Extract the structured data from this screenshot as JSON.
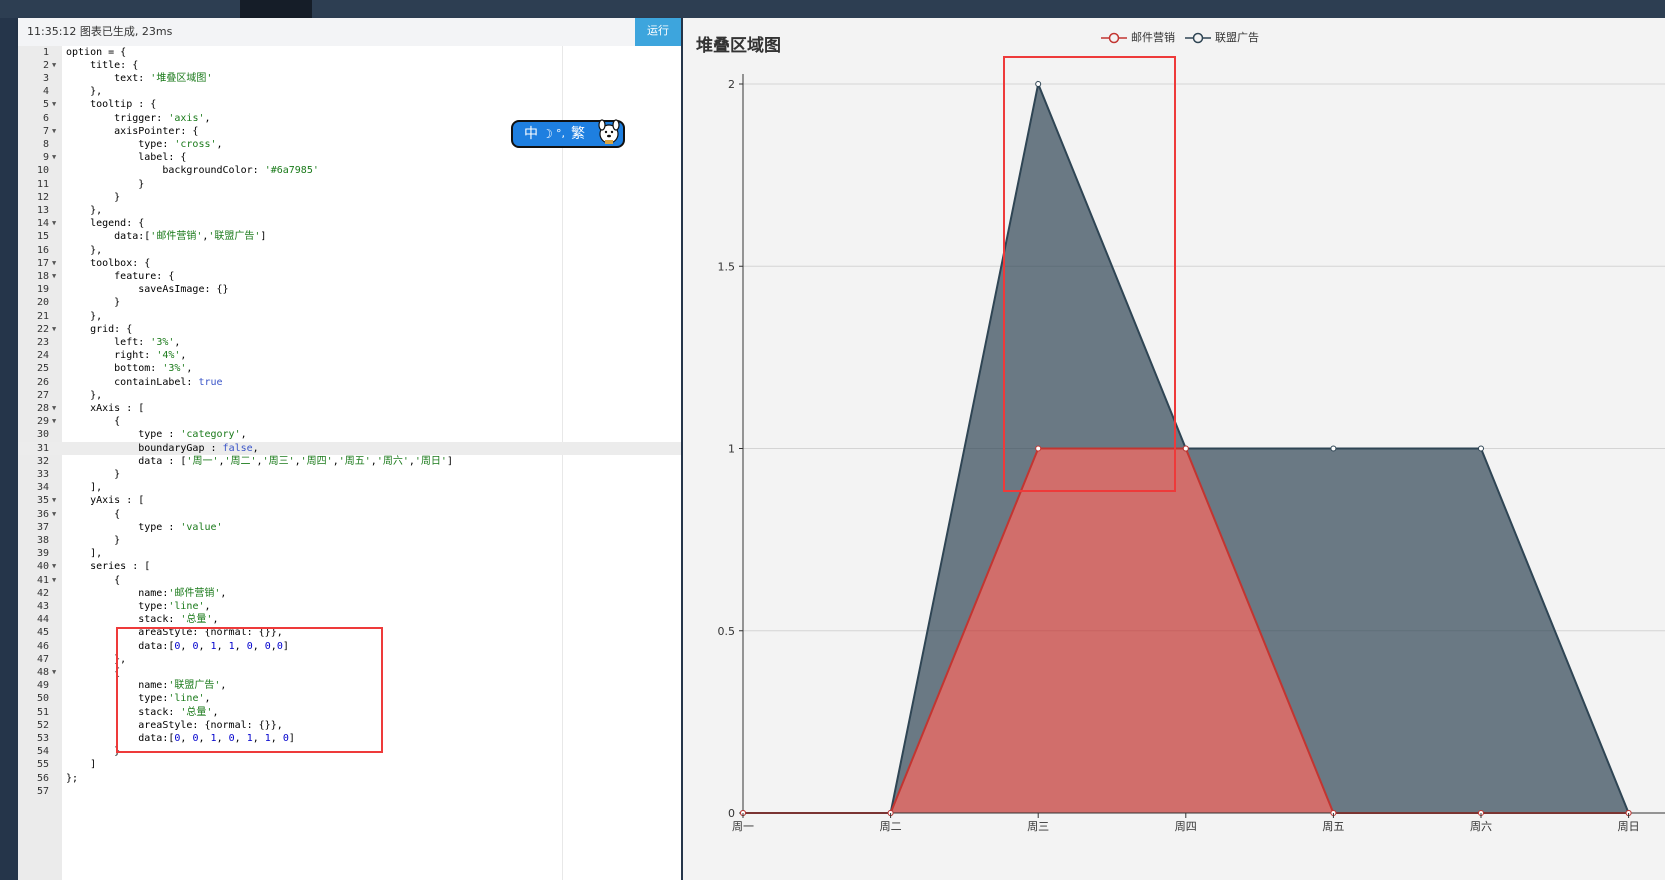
{
  "editor": {
    "status_text": "11:35:12   图表已生成, 23ms",
    "run_label": "运行",
    "code_lines": [
      "option = {",
      "    title: {",
      "        text: '堆叠区域图'",
      "    },",
      "    tooltip : {",
      "        trigger: 'axis',",
      "        axisPointer: {",
      "            type: 'cross',",
      "            label: {",
      "                backgroundColor: '#6a7985'",
      "            }",
      "        }",
      "    },",
      "    legend: {",
      "        data:['邮件营销','联盟广告']",
      "    },",
      "    toolbox: {",
      "        feature: {",
      "            saveAsImage: {}",
      "        }",
      "    },",
      "    grid: {",
      "        left: '3%',",
      "        right: '4%',",
      "        bottom: '3%',",
      "        containLabel: true",
      "    },",
      "    xAxis : [",
      "        {",
      "            type : 'category',",
      "            boundaryGap : false,",
      "            data : ['周一','周二','周三','周四','周五','周六','周日']",
      "        }",
      "    ],",
      "    yAxis : [",
      "        {",
      "            type : 'value'",
      "        }",
      "    ],",
      "    series : [",
      "        {",
      "            name:'邮件营销',",
      "            type:'line',",
      "            stack: '总量',",
      "            areaStyle: {normal: {}},",
      "            data:[0, 0, 1, 1, 0, 0,0]",
      "        },",
      "        {",
      "            name:'联盟广告',",
      "            type:'line',",
      "            stack: '总量',",
      "            areaStyle: {normal: {}},",
      "            data:[0, 0, 1, 0, 1, 1, 0]",
      "        }",
      "    ]",
      "};",
      ""
    ],
    "fold_lines": [
      2,
      5,
      7,
      9,
      14,
      17,
      18,
      22,
      28,
      29,
      35,
      36,
      40,
      41,
      48
    ],
    "active_line": 31
  },
  "widget": {
    "label_zh": "中",
    "moon_glyph": "☽",
    "dot_glyph": "°,",
    "label_trad": "繁",
    "mascot_icon": "dog-mascot-icon"
  },
  "chart": {
    "title": "堆叠区域图",
    "legend": [
      "邮件营销",
      "联盟广告"
    ],
    "colors": {
      "邮件营销": "#c23531",
      "联盟广告": "#2f4554"
    },
    "annotation_color": "#ee3a3a"
  },
  "chart_data": {
    "type": "area",
    "title": "堆叠区域图",
    "stacked": true,
    "categories": [
      "周一",
      "周二",
      "周三",
      "周四",
      "周五",
      "周六",
      "周日"
    ],
    "series": [
      {
        "name": "邮件营销",
        "values": [
          0,
          0,
          1,
          1,
          0,
          0,
          0
        ]
      },
      {
        "name": "联盟广告",
        "values": [
          0,
          0,
          1,
          0,
          1,
          1,
          0
        ]
      }
    ],
    "y_ticks": [
      0,
      0.5,
      1,
      1.5,
      2
    ],
    "ylim": [
      0,
      2
    ],
    "grid": true,
    "legend_position": "top-center"
  }
}
